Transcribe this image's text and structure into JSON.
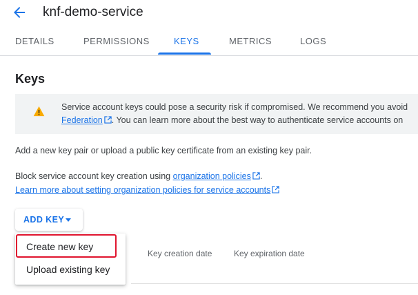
{
  "header": {
    "title": "knf-demo-service",
    "back_icon": "arrow-back-icon"
  },
  "tabs": [
    {
      "label": "DETAILS",
      "active": false
    },
    {
      "label": "PERMISSIONS",
      "active": false
    },
    {
      "label": "KEYS",
      "active": true
    },
    {
      "label": "METRICS",
      "active": false
    },
    {
      "label": "LOGS",
      "active": false
    }
  ],
  "section": {
    "title": "Keys"
  },
  "warning": {
    "icon": "warning-icon",
    "line1": "Service account keys could pose a security risk if compromised. We recommend you avoid",
    "link": "Federation",
    "line2_rest": ". You can learn more about the best way to authenticate service accounts on"
  },
  "body": {
    "p1": "Add a new key pair or upload a public key certificate from an existing key pair.",
    "p2_prefix": "Block service account key creation using ",
    "p2_link": "organization policies",
    "p2_suffix": ".",
    "p3_link": "Learn more about setting organization policies for service accounts"
  },
  "add_key": {
    "label": "ADD KEY"
  },
  "menu": {
    "items": [
      "Create new key",
      "Upload existing key"
    ]
  },
  "table": {
    "columns": [
      "Key creation date",
      "Key expiration date"
    ]
  },
  "colors": {
    "accent": "#1a73e8",
    "warning": "#f9ab00",
    "highlight": "#e0142e"
  }
}
